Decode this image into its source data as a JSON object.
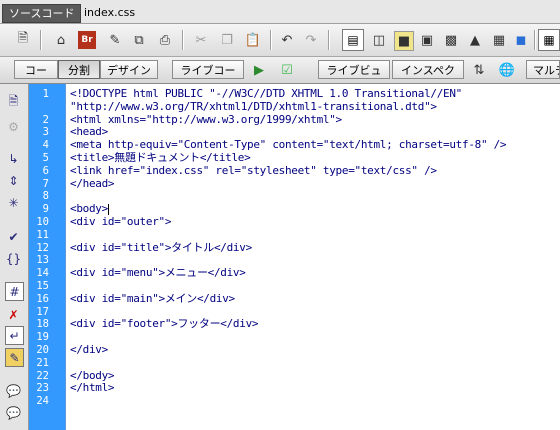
{
  "tabs": {
    "source_label": "ソースコード",
    "file_name": "index.css"
  },
  "toolbar1": {
    "icons": [
      "new-file-icon",
      "home-icon",
      "bridge-icon",
      "edit-icon",
      "copy-page-icon",
      "print-icon",
      "cut-icon",
      "copy-icon",
      "paste-icon",
      "undo-icon",
      "redo-icon",
      "view-code-icon",
      "view-split-icon",
      "view-design-icon",
      "view-live-icon",
      "view-panels-icon",
      "view-media-icon",
      "view-grid-icon",
      "view-toggle-icon"
    ]
  },
  "toolbar2": {
    "code_label": "コード",
    "split_label": "分割",
    "design_label": "デザイン",
    "livecode_label": "ライブコード",
    "liveview_label": "ライブビュー",
    "inspect_label": "インスペクト",
    "multi_label": "マルチ"
  },
  "editor": {
    "line_numbers": [
      "1",
      "2",
      "3",
      "4",
      "5",
      "6",
      "7",
      "8",
      "9",
      "10",
      "11",
      "12",
      "13",
      "14",
      "15",
      "16",
      "17",
      "18",
      "19",
      "20",
      "21",
      "22",
      "23",
      "24"
    ],
    "lines": [
      "<!DOCTYPE html PUBLIC \"-//W3C//DTD XHTML 1.0 Transitional//EN\"",
      "\"http://www.w3.org/TR/xhtml1/DTD/xhtml1-transitional.dtd\">",
      "<html xmlns=\"http://www.w3.org/1999/xhtml\">",
      "<head>",
      "<meta http-equiv=\"Content-Type\" content=\"text/html; charset=utf-8\" />",
      "<title>無題ドキュメント</title>",
      "<link href=\"index.css\" rel=\"stylesheet\" type=\"text/css\" />",
      "</head>",
      "",
      "<body>",
      "<div id=\"outer\">",
      "",
      "<div id=\"title\">タイトル</div>",
      "",
      "<div id=\"menu\">メニュー</div>",
      "",
      "<div id=\"main\">メイン</div>",
      "",
      "<div id=\"footer\">フッター</div>",
      "",
      "</div>",
      "",
      "</body>",
      "</html>",
      ""
    ]
  }
}
